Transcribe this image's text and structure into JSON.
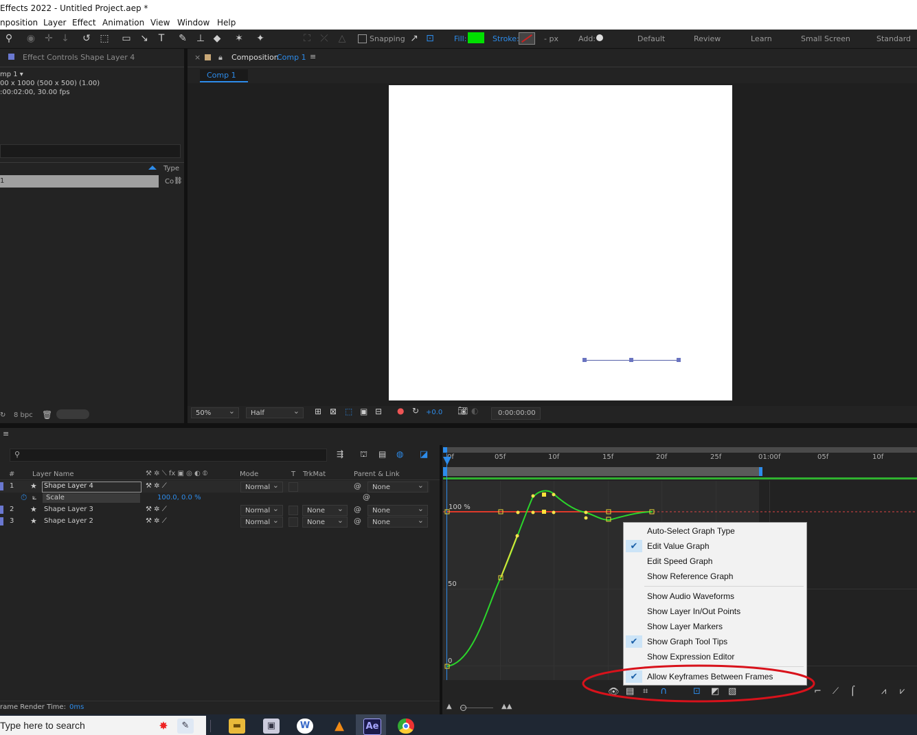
{
  "window_title": "Effects 2022 - Untitled Project.aep *",
  "menu": [
    "nposition",
    "Layer",
    "Effect",
    "Animation",
    "View",
    "Window",
    "Help"
  ],
  "toolbar": {
    "snapping": "Snapping",
    "fill": "Fill:",
    "stroke": "Stroke:",
    "px": "- px",
    "add": "Add:",
    "workspaces": [
      "Default",
      "Review",
      "Learn",
      "Small Screen",
      "Standard"
    ]
  },
  "project_panel": {
    "tab": "Effect Controls Shape Layer 4",
    "comp_name": "mp 1 ▾",
    "info1": "00 x 1000  (500 x 500) (1.00)",
    "info2": ":00:02:00, 30.00 fps",
    "col_type": "Type",
    "item_name": "1",
    "item_type": "Co",
    "bpc": "8 bpc"
  },
  "comp_panel": {
    "tab_prefix": "Composition",
    "tab_name": "Comp 1",
    "subtab": "Comp 1",
    "zoom": "50%",
    "resolution": "Half",
    "exposure": "+0.0",
    "timecode": "0:00:00:00"
  },
  "timeline": {
    "columns": {
      "num": "#",
      "layer_name": "Layer Name",
      "mode": "Mode",
      "t": "T",
      "trkmat": "TrkMat",
      "parent": "Parent & Link"
    },
    "layers": [
      {
        "num": "1",
        "name": "Shape Layer 4",
        "mode": "Normal",
        "trkmat": "",
        "parent": "None"
      },
      {
        "num": "2",
        "name": "Shape Layer 3",
        "mode": "Normal",
        "trkmat": "None",
        "parent": "None"
      },
      {
        "num": "3",
        "name": "Shape Layer 2",
        "mode": "Normal",
        "trkmat": "None",
        "parent": "None"
      }
    ],
    "scale_label": "Scale",
    "scale_value": "100.0, 0.0 %",
    "ruler": [
      "0f",
      "05f",
      "10f",
      "15f",
      "20f",
      "25f",
      "01:00f",
      "05f",
      "10f"
    ],
    "graph_labels": {
      "top": "100 %",
      "mid": "50",
      "bottom": "0"
    },
    "frame_render_label": "rame Render Time:",
    "frame_render_value": "0ms"
  },
  "context_menu": {
    "items": [
      {
        "label": "Auto-Select Graph Type",
        "checked": false
      },
      {
        "label": "Edit Value Graph",
        "checked": true
      },
      {
        "label": "Edit Speed Graph",
        "checked": false
      },
      {
        "label": "Show Reference Graph",
        "checked": false
      },
      {
        "label": "Show Audio Waveforms",
        "checked": false
      },
      {
        "label": "Show Layer In/Out Points",
        "checked": false
      },
      {
        "label": "Show Layer Markers",
        "checked": false
      },
      {
        "label": "Show Graph Tool Tips",
        "checked": true
      },
      {
        "label": "Show Expression Editor",
        "checked": false
      },
      {
        "label": "Allow Keyframes Between Frames",
        "checked": true
      }
    ]
  },
  "taskbar": {
    "search_placeholder": "Type here to search",
    "apps": [
      "W",
      "Ae"
    ]
  },
  "colors": {
    "accent": "#2d8ceb",
    "fill_swatch": "#00e000",
    "graph_green": "#2bd62b",
    "graph_yellow": "#d8e23a",
    "annotation_red": "#d8121b"
  }
}
